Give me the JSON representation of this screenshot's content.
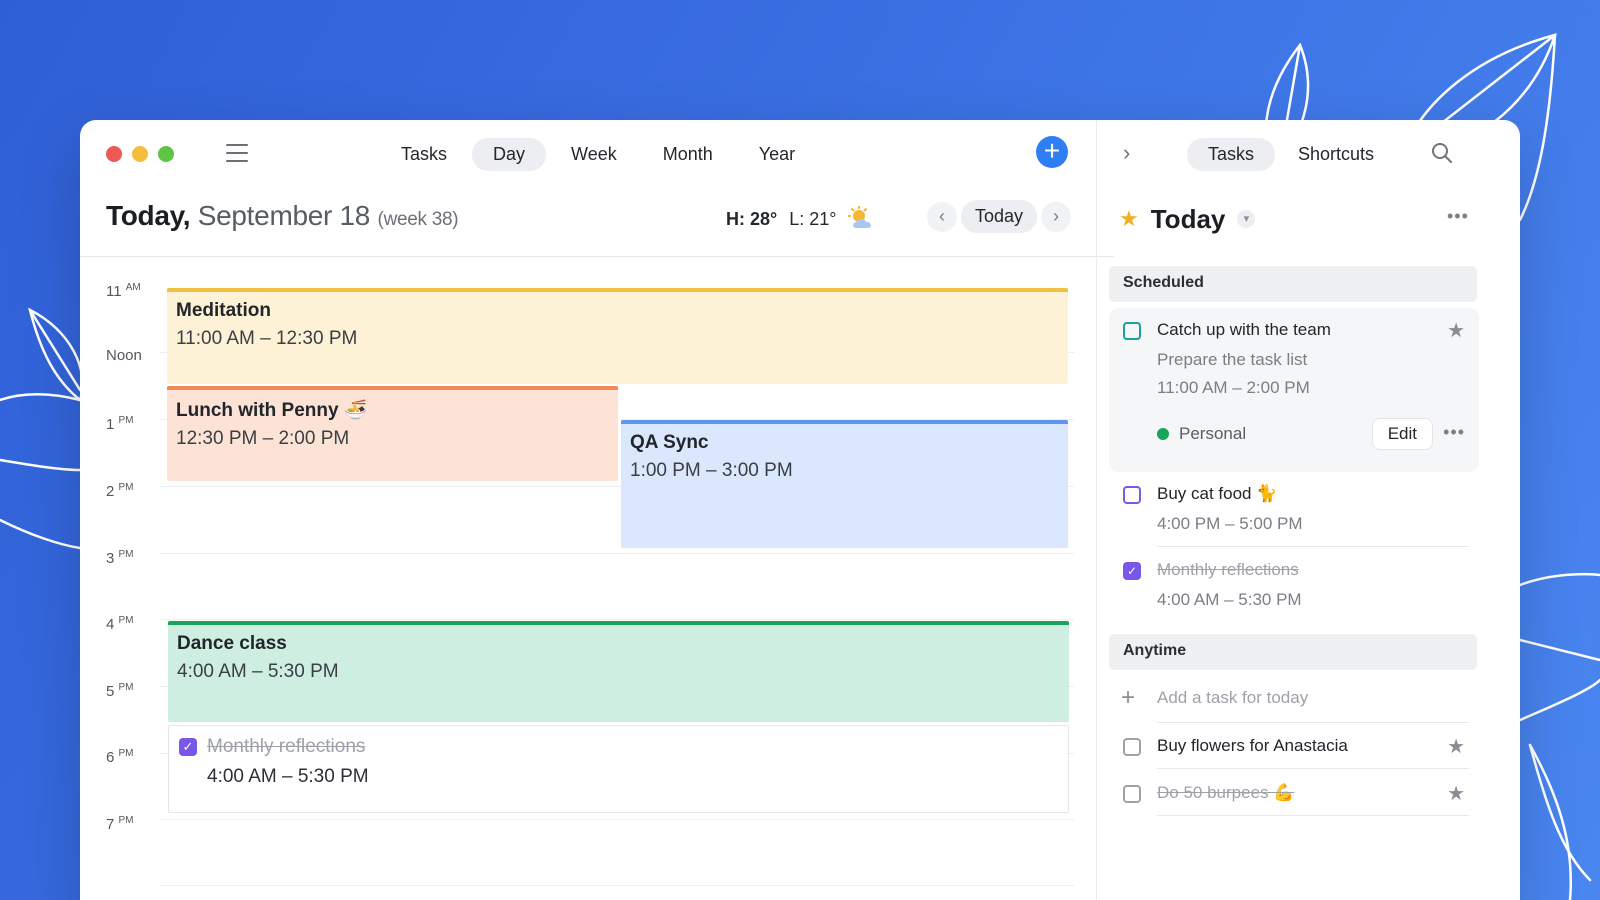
{
  "colors": {
    "accent": "#2f7ff2",
    "meditation": "#f0c040",
    "lunch": "#ef8a55",
    "qa": "#5f96f0",
    "dance": "#19a35b",
    "done_check": "#7b57e8",
    "tag_personal": "#19a35b"
  },
  "header": {
    "menu_icon": "hamburger-icon",
    "views": [
      "Tasks",
      "Day",
      "Week",
      "Month",
      "Year"
    ],
    "active_view": "Day",
    "add_icon": "plus-icon"
  },
  "date_bar": {
    "today": "Today,",
    "date": "September 18",
    "week": "(week 38)",
    "high": "H: 28°",
    "low": "L: 21°",
    "weather_icon": "partly-sunny-icon",
    "today_button": "Today"
  },
  "hours": [
    {
      "num": "11",
      "suffix": "AM"
    },
    {
      "num": "Noon",
      "suffix": ""
    },
    {
      "num": "1",
      "suffix": "PM"
    },
    {
      "num": "2",
      "suffix": "PM"
    },
    {
      "num": "3",
      "suffix": "PM"
    },
    {
      "num": "4",
      "suffix": "PM"
    },
    {
      "num": "5",
      "suffix": "PM"
    },
    {
      "num": "6",
      "suffix": "PM"
    },
    {
      "num": "7",
      "suffix": "PM"
    }
  ],
  "events": {
    "meditation": {
      "title": "Meditation",
      "time": "11:00 AM – 12:30 PM"
    },
    "lunch": {
      "title": "Lunch with Penny 🍜",
      "time": "12:30 PM – 2:00 PM"
    },
    "qa": {
      "title": "QA Sync",
      "time": "1:00 PM – 3:00 PM"
    },
    "dance": {
      "title": "Dance class",
      "time": "4:00 AM – 5:30 PM"
    },
    "monthly": {
      "title": "Monthly reflections",
      "time": "4:00 AM – 5:30 PM",
      "done": true
    }
  },
  "sidebar": {
    "tabs": [
      "Tasks",
      "Shortcuts"
    ],
    "active_tab": "Tasks",
    "title": "Today",
    "scheduled_label": "Scheduled",
    "anytime_label": "Anytime",
    "scheduled": [
      {
        "title": "Catch up with the team",
        "subtitle": "Prepare the task list",
        "time": "11:00 AM – 2:00 PM",
        "tag": "Personal",
        "edit": "Edit",
        "starred": true
      },
      {
        "title": "Buy cat food 🐈",
        "time": "4:00 PM – 5:00 PM"
      },
      {
        "title": "Monthly reflections",
        "time": "4:00 AM – 5:30 PM",
        "done": true
      }
    ],
    "add_placeholder": "Add a task for today",
    "anytime": [
      {
        "title": "Buy flowers for Anastacia",
        "starred": true
      },
      {
        "title": "Do 50 burpees 💪",
        "starred": true,
        "done_strike": true
      }
    ]
  }
}
